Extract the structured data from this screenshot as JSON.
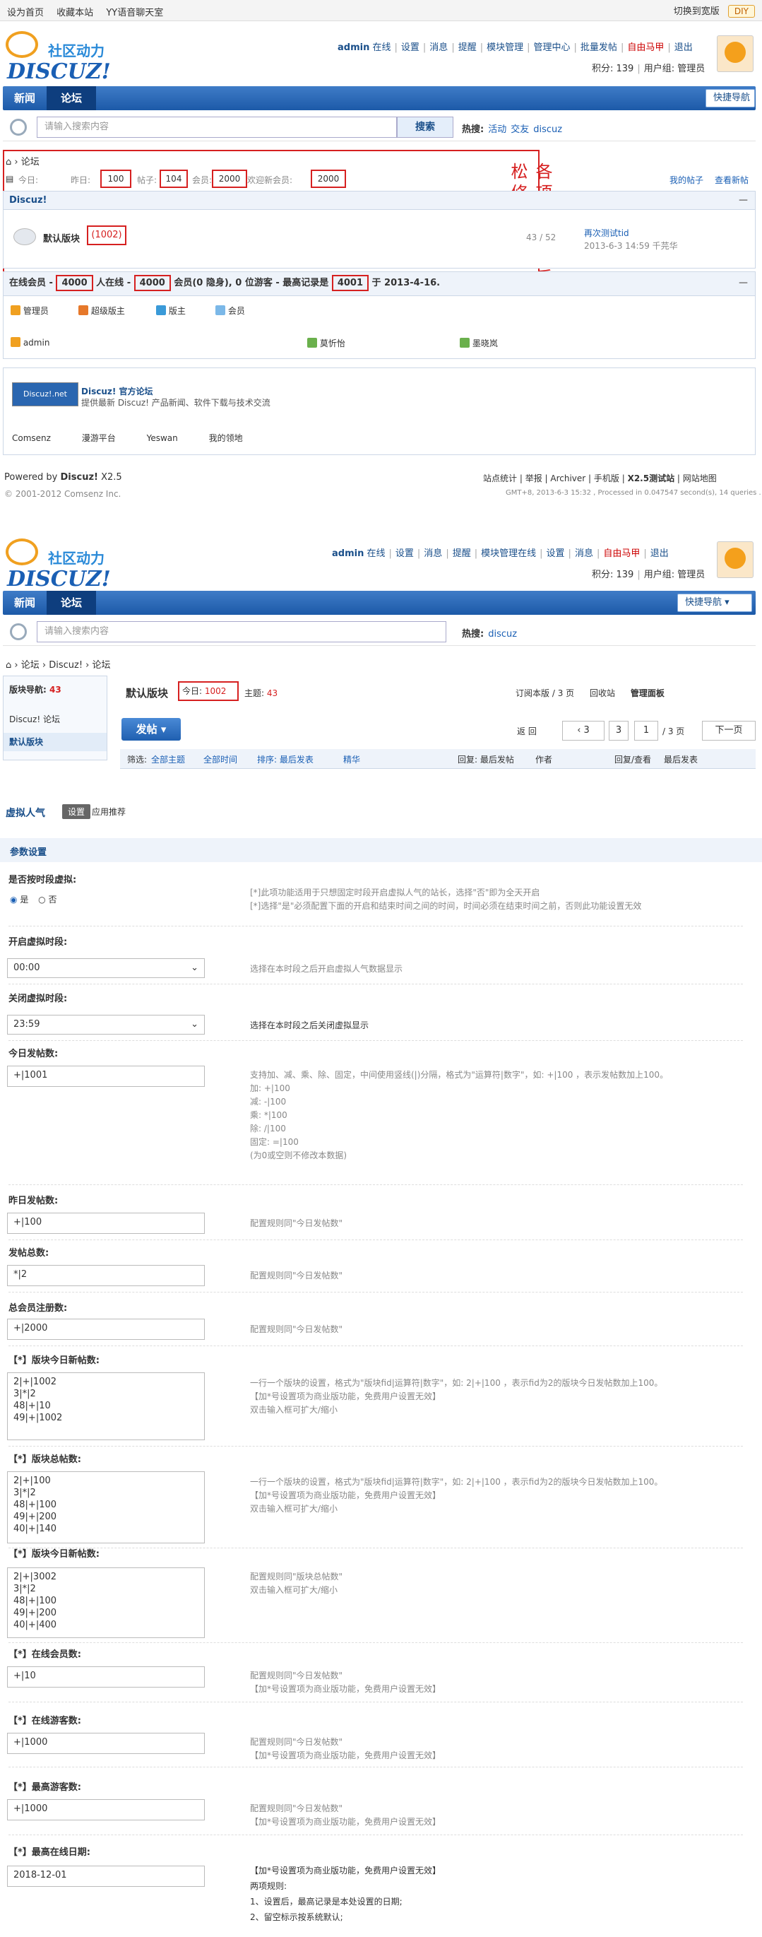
{
  "top": {
    "links": [
      "设为首页",
      "收藏本站",
      "YY语音聊天室"
    ],
    "switch": "切换到宽版",
    "diy": "DIY"
  },
  "logo": {
    "cn": "社区动力",
    "en": "DISCUZ!"
  },
  "user1": {
    "name": "admin",
    "online": "在线",
    "items": [
      "设置",
      "消息",
      "提醒",
      "模块管理",
      "管理中心",
      "批量发帖"
    ],
    "red": "自由马甲",
    "logout": "退出",
    "credits": "积分: 139",
    "group": "用户组: 管理员"
  },
  "nav": {
    "items": [
      "新闻",
      "论坛"
    ],
    "quick": "快捷导航"
  },
  "search": {
    "placeholder": "请输入搜索内容",
    "btn": "搜索",
    "hot_label": "热搜:",
    "hot": [
      "活动",
      "交友",
      "discuz"
    ]
  },
  "forum": {
    "crumb": "论坛",
    "today_label": "今日:",
    "today": "100",
    "yest_label": "昨日:",
    "yest": "",
    "posts_label": "帖子:",
    "posts": "104",
    "members_label": "会员:",
    "members": "2000",
    "newest_label": "欢迎新会员:",
    "newest": "2000",
    "my": "我的帖子",
    "newposts": "查看新帖",
    "cat": "Discuz!",
    "board": "默认版块",
    "board_today": "(1002)",
    "board_stat": "43 / 52",
    "last_title": "再次测试tid",
    "last_time": "2013-6-3 14:59 千芫华",
    "annot": "各项数值，后台轻松修改",
    "online_text_a": "在线会员 - ",
    "online_a": "4000",
    "online_text_b": " 人在线 - ",
    "online_b": "4000",
    "online_text_c": " 会员(0 隐身), 0 位游客 - 最高记录是 ",
    "online_c": "4001",
    "online_text_d": " 于 2013-4-16.",
    "legend": [
      "管理员",
      "超级版主",
      "版主",
      "会员"
    ],
    "online_users": [
      "admin",
      "莫忻怡",
      "墨晓岚"
    ],
    "links_title": "Discuz! 官方论坛",
    "links_desc": "提供最新 Discuz! 产品新闻、软件下载与技术交流",
    "friend": [
      "Comsenz",
      "漫游平台",
      "Yeswan",
      "我的领地"
    ],
    "power": "Powered by",
    "dz": "Discuz!",
    "ver": "X2.5",
    "copy": "© 2001-2012 Comsenz Inc.",
    "foot_links": [
      "站点统计",
      "举报",
      "Archiver",
      "手机版",
      "X2.5测试站",
      "网站地图"
    ],
    "gmt": "GMT+8, 2013-6-3 15:32 , Processed in 0.047547 second(s), 14 queries ."
  },
  "user2": {
    "name": "admin",
    "online": "在线",
    "items": [
      "设置",
      "消息",
      "提醒",
      "模块管理",
      "在线",
      "设置",
      "消息"
    ],
    "red": "自由马甲",
    "logout": "退出",
    "credits": "积分: 139",
    "group": "用户组: 管理员"
  },
  "board2": {
    "crumb": [
      "论坛",
      "Discuz!",
      "论坛"
    ],
    "boards_label": "版块导航:",
    "boards_n": "43",
    "side": [
      "Discuz! 论坛",
      "默认版块"
    ],
    "title": "默认版块",
    "today_label": "今日:",
    "today": "1002",
    "topics_label": "主题:",
    "topics": "43",
    "actions": [
      "订阅本版",
      "回收站",
      "管理面板"
    ],
    "actions_page": "/ 3 页",
    "post_btn": "发帖",
    "back": "返 回",
    "page3": "3",
    "page_in": "1",
    "page_total": "/ 3 页",
    "next": "下一页",
    "filter_label": "筛选:",
    "filters": [
      "全部主题",
      "全部时间",
      "排序: 最后发表",
      "精华"
    ],
    "cols": [
      "回复: 最后发帖",
      "作者",
      "回复/查看",
      "最后发表"
    ]
  },
  "admin": {
    "title": "虚拟人气",
    "tabs": [
      "设置",
      "应用推荐"
    ],
    "section": "参数设置",
    "f1_label": "是否按时段虚拟:",
    "f1_yes": "是",
    "f1_no": "否",
    "f1_hint1": "[*]此项功能适用于只想固定时段开启虚拟人气的站长，选择\"否\"即为全天开启",
    "f1_hint2": "[*]选择\"是\"必须配置下面的开启和结束时间之间的时间，时间必须在结束时间之前，否则此功能设置无效",
    "f2_label": "开启虚拟时段:",
    "f2_val": "00:00",
    "f2_hint": "选择在本时段之后开启虚拟人气数据显示",
    "f3_label": "关闭虚拟时段:",
    "f3_val": "23:59",
    "f3_hint": "选择在本时段之后关闭虚拟显示",
    "f4_label": "今日发帖数:",
    "f4_val": "+|1001",
    "f4_hint": [
      "支持加、减、乘、除、固定，中间使用竖线(|)分隔，格式为\"运算符|数字\"，如: +|100 ，表示发帖数加上100。",
      "加: +|100",
      "减: -|100",
      "乘: *|100",
      "除: /|100",
      "固定: =|100",
      "(为0或空则不修改本数据)"
    ],
    "f5_label": "昨日发帖数:",
    "f5_val": "+|100",
    "f5_hint": "配置规则同\"今日发帖数\"",
    "f6_label": "发帖总数:",
    "f6_val": "*|2",
    "f6_hint": "配置规则同\"今日发帖数\"",
    "f7_label": "总会员注册数:",
    "f7_val": "+|2000",
    "f7_hint": "配置规则同\"今日发帖数\"",
    "f8_label": "【*】版块今日新帖数:",
    "f8_val": "2|+|1002\n3|*|2\n48|+|10\n49|+|1002",
    "f8_hint": [
      "一行一个版块的设置，格式为\"版块fid|运算符|数字\"，如: 2|+|100 ，表示fid为2的版块今日发帖数加上100。",
      "【加*号设置项为商业版功能，免费用户设置无效】",
      "双击输入框可扩大/缩小"
    ],
    "f9_label": "【*】版块总帖数:",
    "f9_val": "2|+|100\n3|*|2\n48|+|100\n49|+|200\n40|+|140",
    "f9_hint": [
      "一行一个版块的设置，格式为\"版块fid|运算符|数字\"，如: 2|+|100 ，表示fid为2的版块今日发帖数加上100。",
      "【加*号设置项为商业版功能，免费用户设置无效】",
      "双击输入框可扩大/缩小"
    ],
    "f10_label": "【*】版块今日新帖数:",
    "f10_val": "2|+|3002\n3|*|2\n48|+|100\n49|+|200\n40|+|400",
    "f10_hint": [
      "配置规则同\"版块总帖数\"",
      "双击输入框可扩大/缩小"
    ],
    "f11_label": "【*】在线会员数:",
    "f11_val": "+|10",
    "f11_hint": [
      "配置规则同\"今日发帖数\"",
      "【加*号设置项为商业版功能，免费用户设置无效】"
    ],
    "f12_label": "【*】在线游客数:",
    "f12_val": "+|1000",
    "f12_hint": [
      "配置规则同\"今日发帖数\"",
      "【加*号设置项为商业版功能，免费用户设置无效】"
    ],
    "f13_label": "【*】最高游客数:",
    "f13_val": "+|1000",
    "f13_hint": [
      "配置规则同\"今日发帖数\"",
      "【加*号设置项为商业版功能，免费用户设置无效】"
    ],
    "f14_label": "【*】最高在线日期:",
    "f14_val": "2018-12-01",
    "f14_hint": [
      "【加*号设置项为商业版功能，免费用户设置无效】",
      "两项规则:",
      "1、设置后，最高记录是本处设置的日期;",
      "2、留空标示按系统默认;"
    ]
  },
  "colors": {
    "nav": "#1c5aa8",
    "red": "#d62020",
    "link": "#1a5fb4"
  }
}
